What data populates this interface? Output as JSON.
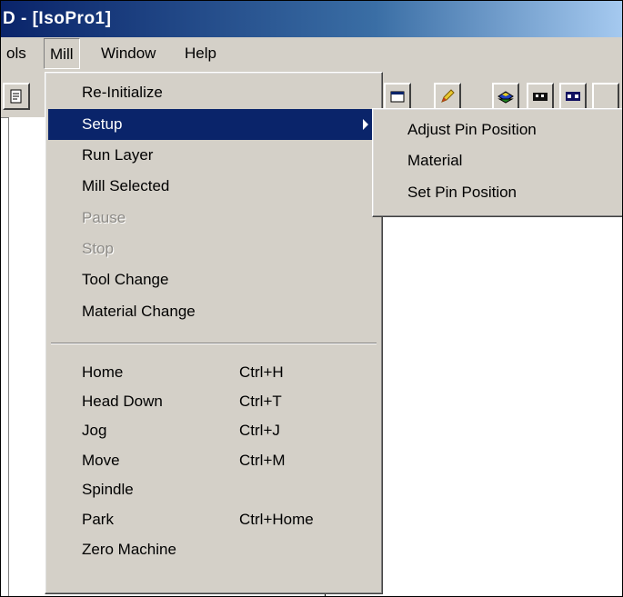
{
  "window": {
    "title": "D - [IsoPro1]"
  },
  "menubar": {
    "items": [
      {
        "label": "ols"
      },
      {
        "label": "Mill"
      },
      {
        "label": "Window"
      },
      {
        "label": "Help"
      }
    ]
  },
  "toolbar": {
    "icons": [
      "document-icon",
      "window-icon",
      "pencil-icon",
      "layer-icon",
      "board-icon",
      "board-pair-icon"
    ]
  },
  "mill_menu": {
    "items": [
      {
        "label": "Re-Initialize",
        "shortcut": ""
      },
      {
        "label": "Setup",
        "shortcut": "",
        "submenu": true,
        "highlighted": true
      },
      {
        "label": "Run Layer",
        "shortcut": ""
      },
      {
        "label": "Mill Selected",
        "shortcut": ""
      },
      {
        "label": "Pause",
        "shortcut": "",
        "disabled": true
      },
      {
        "label": "Stop",
        "shortcut": "",
        "disabled": true
      },
      {
        "label": "Tool Change",
        "shortcut": ""
      },
      {
        "label": "Material Change",
        "shortcut": ""
      },
      {
        "label": "Home",
        "shortcut": "Ctrl+H"
      },
      {
        "label": "Head Down",
        "shortcut": "Ctrl+T"
      },
      {
        "label": "Jog",
        "shortcut": "Ctrl+J"
      },
      {
        "label": "Move",
        "shortcut": "Ctrl+M"
      },
      {
        "label": "Spindle",
        "shortcut": ""
      },
      {
        "label": "Park",
        "shortcut": "Ctrl+Home"
      },
      {
        "label": "Zero Machine",
        "shortcut": ""
      }
    ]
  },
  "setup_submenu": {
    "items": [
      {
        "label": "Adjust Pin Position"
      },
      {
        "label": "Material"
      },
      {
        "label": "Set Pin Position"
      }
    ]
  },
  "colors": {
    "menu_bg": "#d4d0c8",
    "highlight": "#0a246a",
    "title_gradient_start": "#0a246a",
    "title_gradient_end": "#a6caf0"
  }
}
